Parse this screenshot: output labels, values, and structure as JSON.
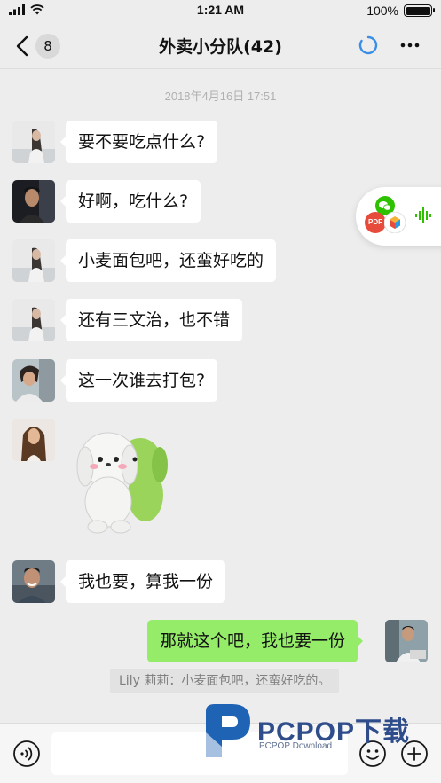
{
  "status": {
    "time": "1:21 AM",
    "battery": "100%"
  },
  "nav": {
    "unread_count": "8",
    "title": "外卖小分队(42)"
  },
  "timestamp": "2018年4月16日 17:51",
  "messages": [
    {
      "text": "要不要吃点什么?"
    },
    {
      "text": "好啊，吃什么?"
    },
    {
      "text": "小麦面包吧，还蛮好吃的"
    },
    {
      "text": "还有三文治，也不错"
    },
    {
      "text": "这一次谁去打包?"
    },
    {
      "sticker": "dog-sticker"
    },
    {
      "text": "我也要，算我一份"
    },
    {
      "text": "那就这个吧，我也要一份",
      "mine": true
    }
  ],
  "quote": "Lily 莉莉：小麦面包吧，还蛮好吃的。",
  "float_ball": {
    "pdf_label": "PDF"
  },
  "watermark": {
    "brand": "PCPOP下载",
    "sub": "PCPOP Download"
  },
  "colors": {
    "my_bubble": "#95ec69",
    "background": "#ededed",
    "sync_blue": "#3a8ee6"
  }
}
